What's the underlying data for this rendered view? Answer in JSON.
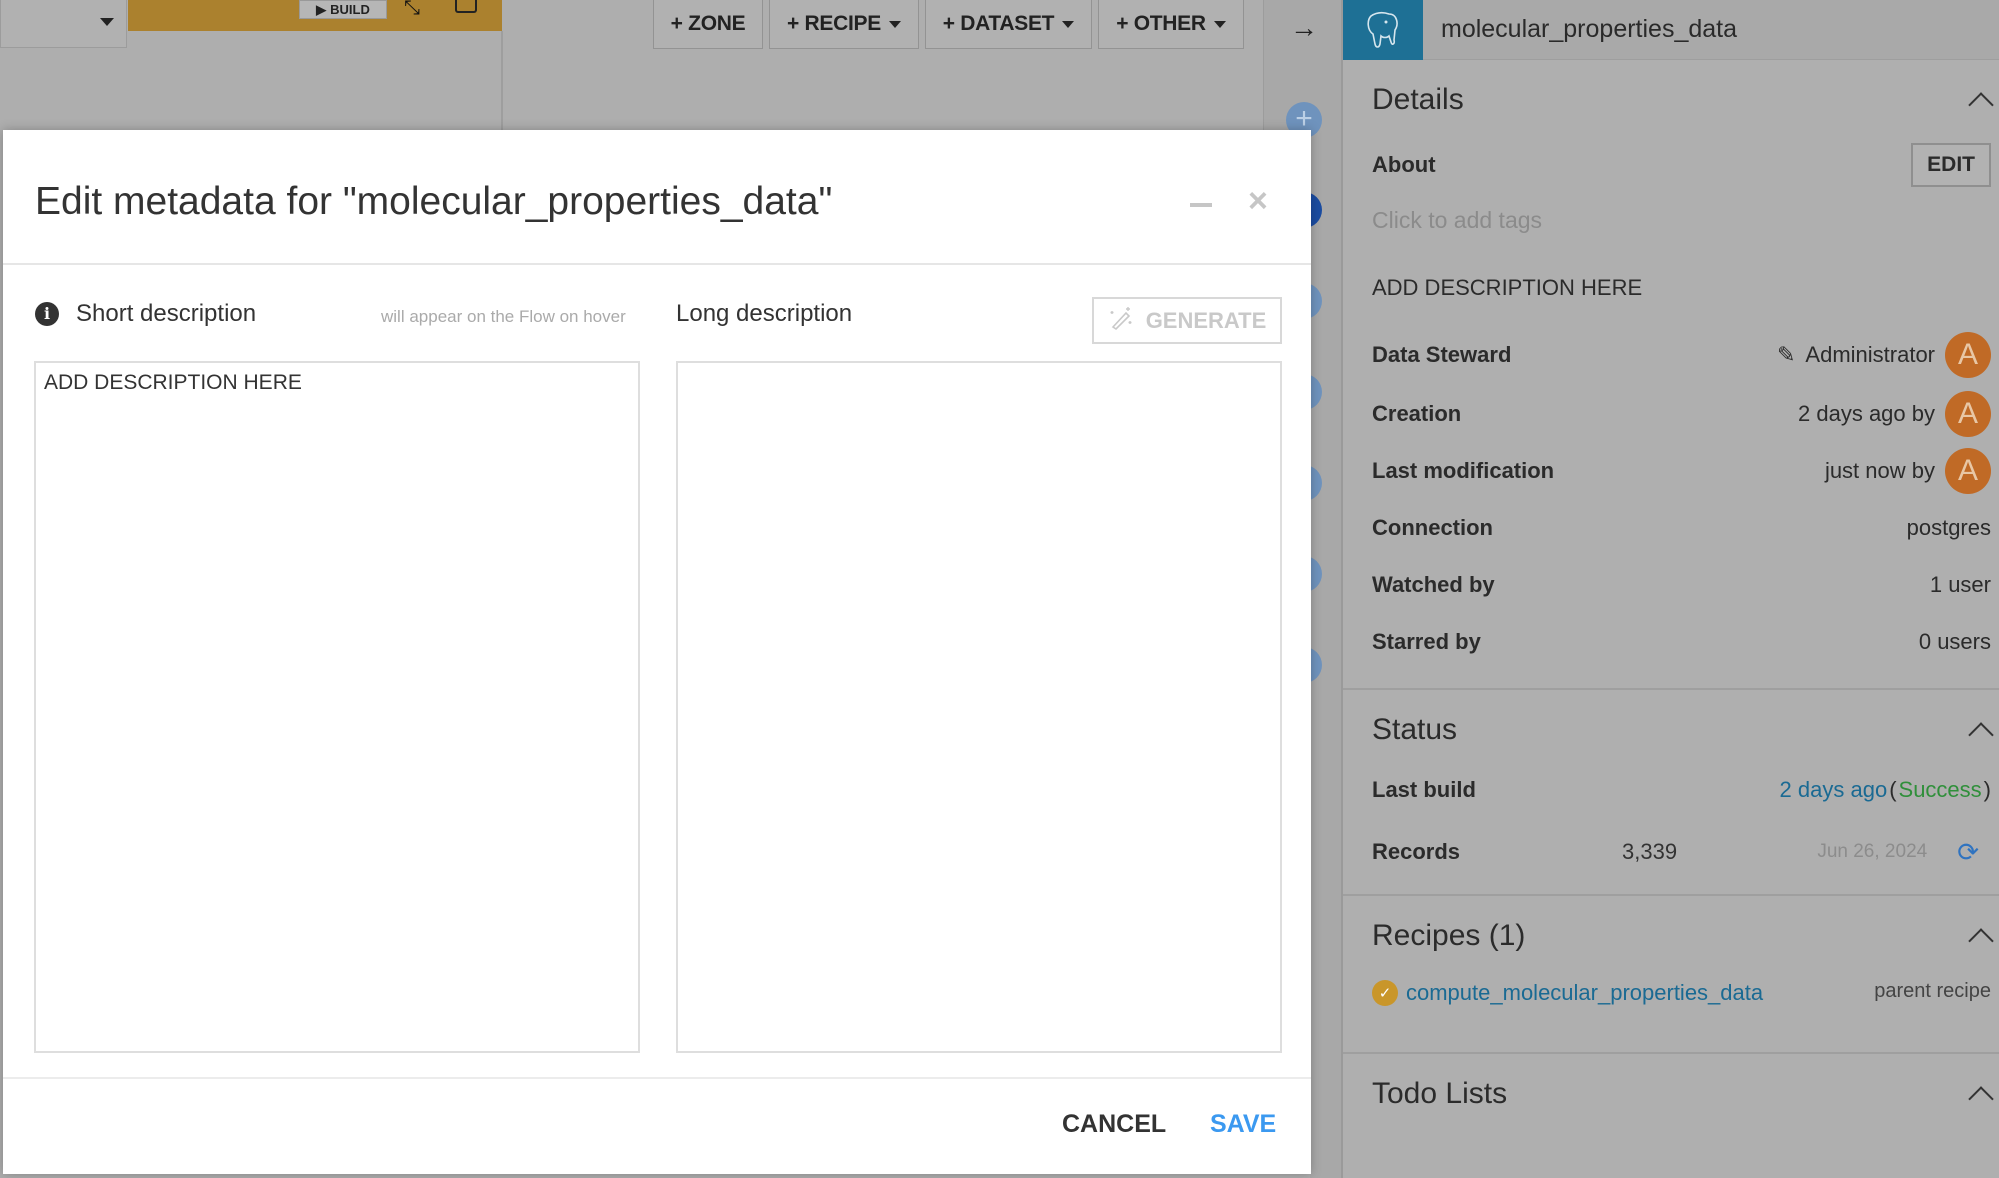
{
  "background": {
    "build_label": "BUILD",
    "toolbar_buttons": [
      {
        "label": "+ ZONE",
        "has_dropdown": false
      },
      {
        "label": "+ RECIPE",
        "has_dropdown": true
      },
      {
        "label": "+ DATASET",
        "has_dropdown": true
      },
      {
        "label": "+ OTHER",
        "has_dropdown": true
      }
    ],
    "zone_color": "#ab812e"
  },
  "panel": {
    "dataset_name": "molecular_properties_data",
    "details": {
      "title": "Details",
      "about_label": "About",
      "edit_label": "EDIT",
      "tags_placeholder": "Click to add tags",
      "description": "ADD DESCRIPTION HERE",
      "rows": {
        "data_steward": {
          "label": "Data Steward",
          "value": "Administrator",
          "avatar": "A"
        },
        "creation": {
          "label": "Creation",
          "value": "2 days ago by",
          "avatar": "A"
        },
        "last_modification": {
          "label": "Last modification",
          "value": "just now by",
          "avatar": "A"
        },
        "connection": {
          "label": "Connection",
          "value": "postgres"
        },
        "watched_by": {
          "label": "Watched by",
          "value": "1 user"
        },
        "starred_by": {
          "label": "Starred by",
          "value": "0 users"
        }
      }
    },
    "status": {
      "title": "Status",
      "last_build_label": "Last build",
      "last_build_when": "2 days ago",
      "last_build_open": "(",
      "last_build_result": "Success",
      "last_build_close": ")",
      "records_label": "Records",
      "records_value": "3,339",
      "records_date": "Jun 26, 2024"
    },
    "recipes": {
      "title": "Recipes (1)",
      "items": [
        {
          "name": "compute_molecular_properties_data",
          "role": "parent recipe"
        }
      ]
    },
    "todo": {
      "title": "Todo Lists"
    },
    "colors": {
      "link": "#1a6a93",
      "success": "#2f8f3a",
      "avatar": "#c06a26",
      "db_icon_bg": "#1e7095"
    }
  },
  "modal": {
    "title": "Edit metadata for \"molecular_properties_data\"",
    "short_description": {
      "label": "Short description",
      "hint": "will appear on the Flow on hover",
      "value": "ADD DESCRIPTION HERE"
    },
    "long_description": {
      "label": "Long description",
      "value": "",
      "generate_label": "GENERATE"
    },
    "cancel_label": "CANCEL",
    "save_label": "SAVE",
    "save_color": "#3b99f0"
  }
}
